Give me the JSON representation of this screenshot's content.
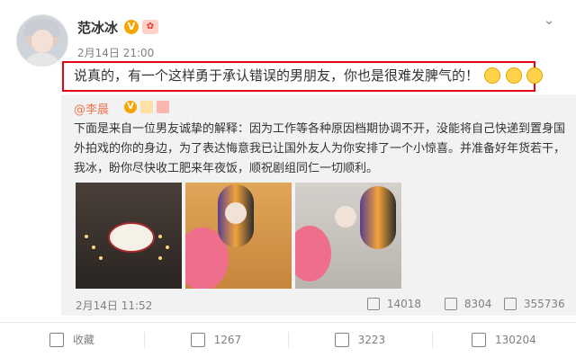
{
  "post": {
    "author": "范冰冰",
    "time": "2月14日 21:00",
    "text": "说真的，有一个这样勇于承认错误的男朋友，你也是很难发脾气的！"
  },
  "repost": {
    "author": "@李晨",
    "text": "下面是来自一位男友诚挚的解释：因为工作等各种原因档期协调不开，没能将自己快递到置身国外拍戏的你的身边，为了表达悔意我已让国外友人为你安排了一个小惊喜。并准备好年货若干，我冰，盼你尽快收工肥来年夜饭，顺祝剧组同仁一切顺利。",
    "time": "2月14日 11:52",
    "stats": {
      "reposts": "14018",
      "comments": "8304",
      "likes": "355736"
    }
  },
  "actions": {
    "favorite": "收藏",
    "repost_count": "1267",
    "comment_count": "3223",
    "like_count": "130204"
  },
  "icons": [
    "more-icon",
    "verified-icon",
    "medal-icon",
    "crying-laugh-emoji",
    "favorite-icon",
    "repost-icon",
    "comment-icon",
    "like-icon"
  ]
}
